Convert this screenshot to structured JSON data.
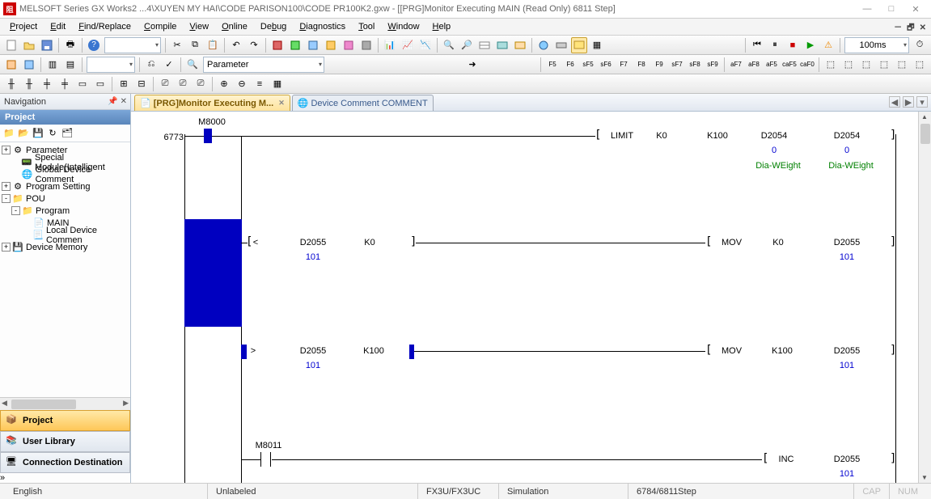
{
  "title": "MELSOFT Series GX Works2 ...4\\XUYEN MY HAI\\CODE PARISON100\\CODE PR100K2.gxw - [[PRG]Monitor Executing MAIN (Read Only) 6811 Step]",
  "menu": [
    "Project",
    "Edit",
    "Find/Replace",
    "Compile",
    "View",
    "Online",
    "Debug",
    "Diagnostics",
    "Tool",
    "Window",
    "Help"
  ],
  "toolbar": {
    "paramLabel": "Parameter",
    "timing": "100ms"
  },
  "nav": {
    "header": "Navigation",
    "section": "Project",
    "items": [
      {
        "label": "Parameter",
        "icon": "gear",
        "exp": "+",
        "depth": 0
      },
      {
        "label": "Special Module(Intelligent",
        "icon": "module",
        "depth": 1
      },
      {
        "label": "Global Device Comment",
        "icon": "globe",
        "depth": 1
      },
      {
        "label": "Program Setting",
        "icon": "gears",
        "exp": "+",
        "depth": 0
      },
      {
        "label": "POU",
        "icon": "folder",
        "exp": "-",
        "depth": 0
      },
      {
        "label": "Program",
        "icon": "folder",
        "exp": "-",
        "depth": 1
      },
      {
        "label": "MAIN",
        "icon": "prg",
        "depth": 2
      },
      {
        "label": "Local Device Commen",
        "icon": "doc",
        "depth": 2
      },
      {
        "label": "Device Memory",
        "icon": "mem",
        "exp": "+",
        "depth": 0
      }
    ],
    "bottom": [
      {
        "label": "Project",
        "sel": true,
        "icon": "proj"
      },
      {
        "label": "User Library",
        "icon": "lib"
      },
      {
        "label": "Connection Destination",
        "icon": "conn"
      }
    ]
  },
  "tabs": [
    {
      "label": "[PRG]Monitor Executing M...",
      "active": true,
      "icon": "prg"
    },
    {
      "label": "Device Comment COMMENT",
      "icon": "globe"
    }
  ],
  "ladder": {
    "step": "6773",
    "m8000": "M8000",
    "rung1": {
      "op": "LIMIT",
      "args": [
        "K0",
        "K100",
        "D2054",
        "D2054"
      ],
      "vals": [
        "0",
        "0"
      ],
      "cmt": [
        "Dia-WEight",
        "Dia-WEight"
      ]
    },
    "rung2": {
      "cmp": "<",
      "args": [
        "D2055",
        "K0"
      ],
      "val": "101",
      "op": "MOV",
      "oargs": [
        "K0",
        "D2055"
      ],
      "oval": "101"
    },
    "rung3": {
      "cmp": ">",
      "args": [
        "D2055",
        "K100"
      ],
      "val": "101",
      "op": "MOV",
      "oargs": [
        "K100",
        "D2055"
      ],
      "oval": "101"
    },
    "rung4": {
      "contact": "M8011",
      "op": "INC",
      "oargs": [
        "D2055"
      ],
      "oval": "101"
    }
  },
  "status": {
    "lang": "English",
    "lbl": "Unlabeled",
    "cpu": "FX3U/FX3UC",
    "mode": "Simulation",
    "step": "6784/6811Step",
    "cap": "CAP",
    "num": "NUM"
  }
}
